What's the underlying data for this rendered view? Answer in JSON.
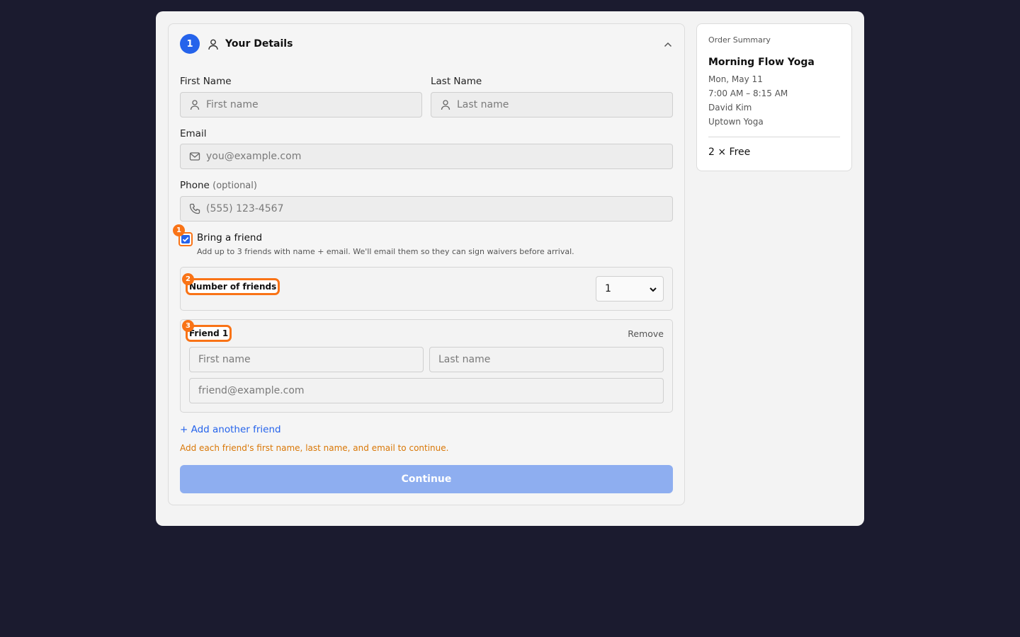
{
  "step": {
    "number": "1",
    "title": "Your Details"
  },
  "form": {
    "first_name": {
      "label": "First Name",
      "placeholder": "First name"
    },
    "last_name": {
      "label": "Last Name",
      "placeholder": "Last name"
    },
    "email": {
      "label": "Email",
      "placeholder": "you@example.com"
    },
    "phone": {
      "label": "Phone",
      "optional": "(optional)",
      "placeholder": "(555) 123-4567"
    },
    "bring_friend": {
      "label": "Bring a friend",
      "checked": true,
      "help": "Add up to 3 friends with name + email. We'll email them so they can sign waivers before arrival."
    },
    "friends_count": {
      "label": "Number of friends",
      "selected": "1"
    },
    "friend1": {
      "title": "Friend 1",
      "remove": "Remove",
      "first_placeholder": "First name",
      "last_placeholder": "Last name",
      "email_placeholder": "friend@example.com"
    },
    "add_friend": "+ Add another friend",
    "warning": "Add each friend's first name, last name, and email to continue.",
    "continue": "Continue"
  },
  "markers": [
    "1",
    "2",
    "3"
  ],
  "summary": {
    "heading": "Order Summary",
    "title": "Morning Flow Yoga",
    "date": "Mon, May 11",
    "time": "7:00 AM – 8:15 AM",
    "instructor": "David Kim",
    "location": "Uptown Yoga",
    "price": "2 × Free"
  },
  "colors": {
    "accent": "#2563eb",
    "highlight": "#f97316",
    "warning": "#d97706",
    "background": "#1b1b2f"
  }
}
